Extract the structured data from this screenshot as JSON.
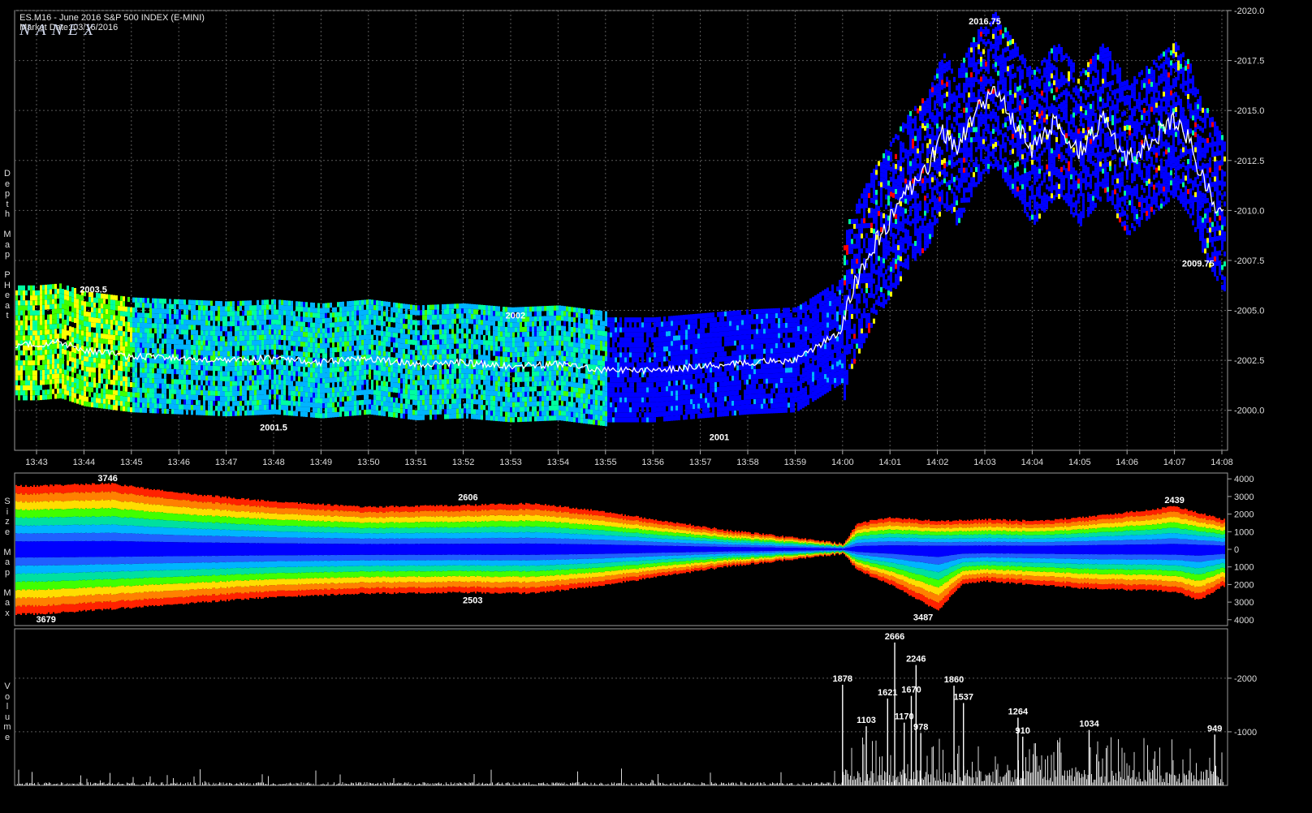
{
  "header": {
    "symbol": "ES.M16 - June 2016 S&P 500 INDEX (E-MINI)",
    "market_date": "Market Date: 03/16/2016",
    "logo": "NANEX"
  },
  "panels": {
    "depth": {
      "label": "Depth Map PHeat"
    },
    "size": {
      "label": "Size Map Max"
    },
    "volume": {
      "label": "Volume"
    }
  },
  "colors": {
    "background": "#000000",
    "grid": "#5a5a5a",
    "price_line": "#ffffff",
    "heat_scale": [
      "#0000ff",
      "#00b4ff",
      "#00ffa0",
      "#40ff00",
      "#ffff00",
      "#ff8000",
      "#ff0000"
    ]
  },
  "chart_data": [
    {
      "type": "heatmap",
      "name": "Depth Map PHeat",
      "x_ticks": [
        "13:43",
        "13:44",
        "13:45",
        "13:46",
        "13:47",
        "13:48",
        "13:49",
        "13:50",
        "13:51",
        "13:52",
        "13:53",
        "13:54",
        "13:55",
        "13:56",
        "13:57",
        "13:58",
        "13:59",
        "14:00",
        "14:01",
        "14:02",
        "14:03",
        "14:04",
        "14:05",
        "14:06",
        "14:07",
        "14:08"
      ],
      "y_ticks": [
        "2000.0",
        "2002.5",
        "2005.0",
        "2007.5",
        "2010.0",
        "2012.5",
        "2015.0",
        "2017.5",
        "2020.0"
      ],
      "ylim": [
        1998.0,
        2020.0
      ],
      "price_path": {
        "minutes": [
          0,
          0.5,
          1,
          2,
          3,
          4,
          5,
          6,
          7,
          8,
          9,
          10,
          11,
          12,
          13,
          14,
          15,
          16,
          17,
          17.1,
          17.3,
          17.6,
          18,
          18.4,
          18.8,
          19.1,
          19.4,
          19.8,
          20.2,
          20.6,
          21,
          21.5,
          22,
          22.5,
          23,
          23.5,
          24,
          24.3,
          24.6,
          25
        ],
        "price": [
          2003.3,
          2003.4,
          2003.0,
          2002.7,
          2002.6,
          2002.5,
          2002.6,
          2002.4,
          2002.6,
          2002.3,
          2002.4,
          2002.2,
          2002.3,
          2002.0,
          2002.0,
          2002.2,
          2002.4,
          2002.5,
          2004.0,
          2005.5,
          2006.5,
          2008.0,
          2009.5,
          2011.0,
          2012.0,
          2014.0,
          2013.0,
          2015.0,
          2016.0,
          2014.5,
          2013.0,
          2014.5,
          2013.0,
          2014.5,
          2012.5,
          2013.5,
          2014.5,
          2013.5,
          2011.5,
          2009.75
        ]
      },
      "annotations": [
        {
          "label": "2003.5",
          "minute": 1.2,
          "price": 2005.9
        },
        {
          "label": "2002",
          "minute": 10.1,
          "price": 2004.6
        },
        {
          "label": "2001.5",
          "minute": 5.0,
          "price": 1999.0
        },
        {
          "label": "2001",
          "minute": 14.4,
          "price": 1998.5
        },
        {
          "label": "2016.75",
          "minute": 20.0,
          "price": 2019.3
        },
        {
          "label": "2009.75",
          "minute": 24.5,
          "price": 2007.2
        }
      ]
    },
    {
      "type": "heatmap",
      "name": "Size Map Max",
      "y_ticks": [
        "4000",
        "3000",
        "2000",
        "1000",
        "0",
        "1000",
        "2000",
        "3000",
        "4000"
      ],
      "ylim": [
        -4000,
        4000
      ],
      "top_envelope": {
        "minutes": [
          0,
          1.5,
          3,
          5,
          7,
          9,
          10.5,
          11.5,
          12.5,
          13.5,
          14.5,
          15.5,
          16.5,
          17.0,
          17.3,
          18,
          19,
          20,
          21,
          22,
          23,
          24,
          25
        ],
        "size": [
          3600,
          3746,
          3200,
          2700,
          2400,
          2500,
          2606,
          2300,
          1900,
          1500,
          1100,
          800,
          500,
          300,
          1500,
          1800,
          1600,
          1700,
          1600,
          1800,
          2100,
          2439,
          1700
        ]
      },
      "bottom_envelope": {
        "minutes": [
          0,
          1.5,
          3,
          5,
          7,
          9,
          10.5,
          11.5,
          12.5,
          13.5,
          14.5,
          15.5,
          16.5,
          17.0,
          17.3,
          18,
          19,
          19.5,
          20,
          21,
          22,
          23,
          24,
          24.5,
          25
        ],
        "size": [
          3679,
          3400,
          3100,
          2700,
          2500,
          2450,
          2503,
          2200,
          1800,
          1400,
          1000,
          700,
          400,
          250,
          1200,
          2000,
          3487,
          2000,
          1800,
          2000,
          2200,
          2300,
          2400,
          2900,
          2100
        ]
      },
      "annotations": [
        {
          "label": "3746",
          "minute": 1.5,
          "size": 3746
        },
        {
          "label": "3679",
          "minute": 0.2,
          "size": -3679
        },
        {
          "label": "2606",
          "minute": 9.1,
          "size": 2606
        },
        {
          "label": "2503",
          "minute": 9.2,
          "size": -2503
        },
        {
          "label": "3487",
          "minute": 18.7,
          "size": -3487
        },
        {
          "label": "2439",
          "minute": 24.0,
          "size": 2439
        }
      ]
    },
    {
      "type": "bar",
      "name": "Volume",
      "y_ticks": [
        "1000",
        "2000"
      ],
      "ylim": [
        0,
        2800
      ],
      "labeled_bars": [
        {
          "label": "1878",
          "minute": 17.0,
          "value": 1878
        },
        {
          "label": "1103",
          "minute": 17.5,
          "value": 1103
        },
        {
          "label": "1621",
          "minute": 17.95,
          "value": 1621
        },
        {
          "label": "2666",
          "minute": 18.1,
          "value": 2666
        },
        {
          "label": "1170",
          "minute": 18.3,
          "value": 1170
        },
        {
          "label": "1670",
          "minute": 18.45,
          "value": 1670
        },
        {
          "label": "2246",
          "minute": 18.55,
          "value": 2246
        },
        {
          "label": "978",
          "minute": 18.65,
          "value": 978
        },
        {
          "label": "1860",
          "minute": 19.35,
          "value": 1860
        },
        {
          "label": "1537",
          "minute": 19.55,
          "value": 1537
        },
        {
          "label": "1264",
          "minute": 20.7,
          "value": 1264
        },
        {
          "label": "910",
          "minute": 20.8,
          "value": 910
        },
        {
          "label": "1034",
          "minute": 22.2,
          "value": 1034
        },
        {
          "label": "949",
          "minute": 24.85,
          "value": 949
        }
      ]
    }
  ]
}
